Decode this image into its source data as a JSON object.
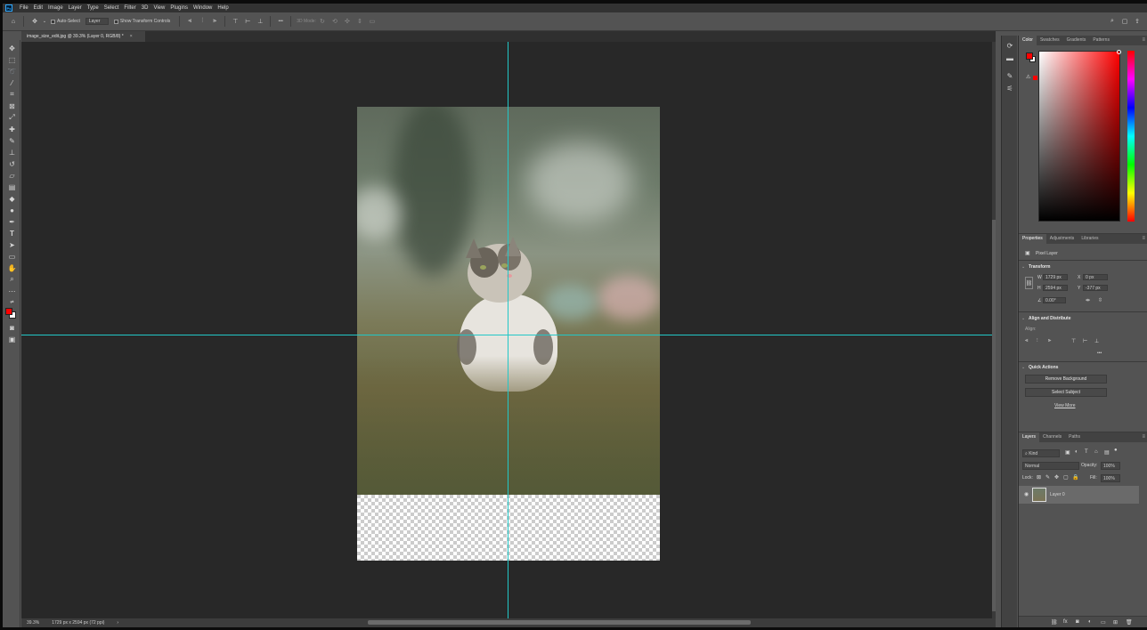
{
  "menubar": {
    "logo": "Ps",
    "items": [
      "File",
      "Edit",
      "Image",
      "Layer",
      "Type",
      "Select",
      "Filter",
      "3D",
      "View",
      "Plugins",
      "Window",
      "Help"
    ]
  },
  "options": {
    "auto_select": "Auto-Select",
    "layer_dropdown": "Layer",
    "show_transform": "Show Transform Controls",
    "mode_3d": "3D Mode:",
    "more": "•••"
  },
  "document": {
    "tab_title": "image_size_edit.jpg @ 39.3% (Layer 0, RGB/8) *",
    "close": "×"
  },
  "status": {
    "zoom": "39.3%",
    "dimensions": "1729 px x 2594 px (72 ppi)",
    "arrow": "›"
  },
  "color_panel": {
    "tabs": [
      "Color",
      "Swatches",
      "Gradients",
      "Patterns"
    ],
    "foreground": "#ff0000",
    "background": "#ffffff",
    "hue": "#ff0000"
  },
  "properties_panel": {
    "tabs": [
      "Properties",
      "Adjustments",
      "Libraries"
    ],
    "layer_type": "Pixel Layer",
    "transform_heading": "Transform",
    "w_label": "W",
    "w_value": "1729 px",
    "h_label": "H",
    "h_value": "2594 px",
    "x_label": "X",
    "x_value": "0 px",
    "y_label": "Y",
    "y_value": "-377 px",
    "angle": "0.00°",
    "align_heading": "Align and Distribute",
    "align_label": "Align:",
    "quick_heading": "Quick Actions",
    "remove_bg": "Remove Background",
    "select_subject": "Select Subject",
    "view_more": "View More"
  },
  "layers_panel": {
    "tabs": [
      "Layers",
      "Channels",
      "Paths"
    ],
    "kind": "Kind",
    "blend_mode": "Normal",
    "opacity_label": "Opacity:",
    "opacity": "100%",
    "lock_label": "Lock:",
    "fill_label": "Fill:",
    "fill": "100%",
    "layer_name": "Layer 0"
  }
}
